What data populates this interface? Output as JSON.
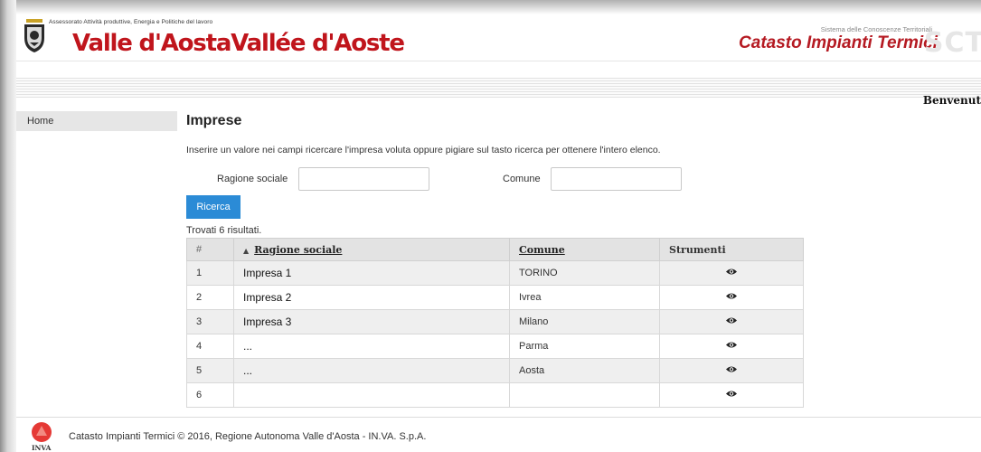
{
  "header": {
    "assessorato": "Assessorato Attività produttive, Energia e Politiche del lavoro",
    "brand": "Valle d'AostaVallée d'Aoste",
    "sistema": "Sistema delle Conoscenze Territoriali",
    "app_title": "Catasto Impianti Termici",
    "logo_text": "SCT"
  },
  "welcome": "Benvenut",
  "sidebar": {
    "items": [
      {
        "label": "Home"
      }
    ]
  },
  "page": {
    "title": "Imprese",
    "instruction": "Inserire un valore nei campi ricercare l'impresa voluta oppure pigiare sul tasto ricerca per ottenere l'intero elenco."
  },
  "search": {
    "ragione_label": "Ragione sociale",
    "ragione_value": "",
    "comune_label": "Comune",
    "comune_value": "",
    "button_label": "Ricerca"
  },
  "results_text": "Trovati 6 risultati.",
  "table": {
    "headers": {
      "num": "#",
      "sort_arrow": "▲",
      "ragione": "Ragione sociale",
      "comune": "Comune",
      "strumenti": "Strumenti"
    },
    "rows": [
      {
        "num": "1",
        "ragione": "Impresa 1",
        "comune": "TORINO"
      },
      {
        "num": "2",
        "ragione": "Impresa 2",
        "comune": "Ivrea"
      },
      {
        "num": "3",
        "ragione": "Impresa 3",
        "comune": "Milano"
      },
      {
        "num": "4",
        "ragione": "...",
        "comune": "Parma"
      },
      {
        "num": "5",
        "ragione": "...",
        "comune": "Aosta"
      },
      {
        "num": "6",
        "ragione": "",
        "comune": ""
      }
    ]
  },
  "footer": {
    "text": "Catasto Impianti Termici © 2016, Regione Autonoma Valle d'Aosta - IN.VA. S.p.A.",
    "logo_text": "INVA"
  },
  "colors": {
    "brand_red": "#c0151c",
    "button_blue": "#2b8bd6"
  },
  "icons": {
    "tool": "eye-icon",
    "crest": "crest-icon"
  }
}
